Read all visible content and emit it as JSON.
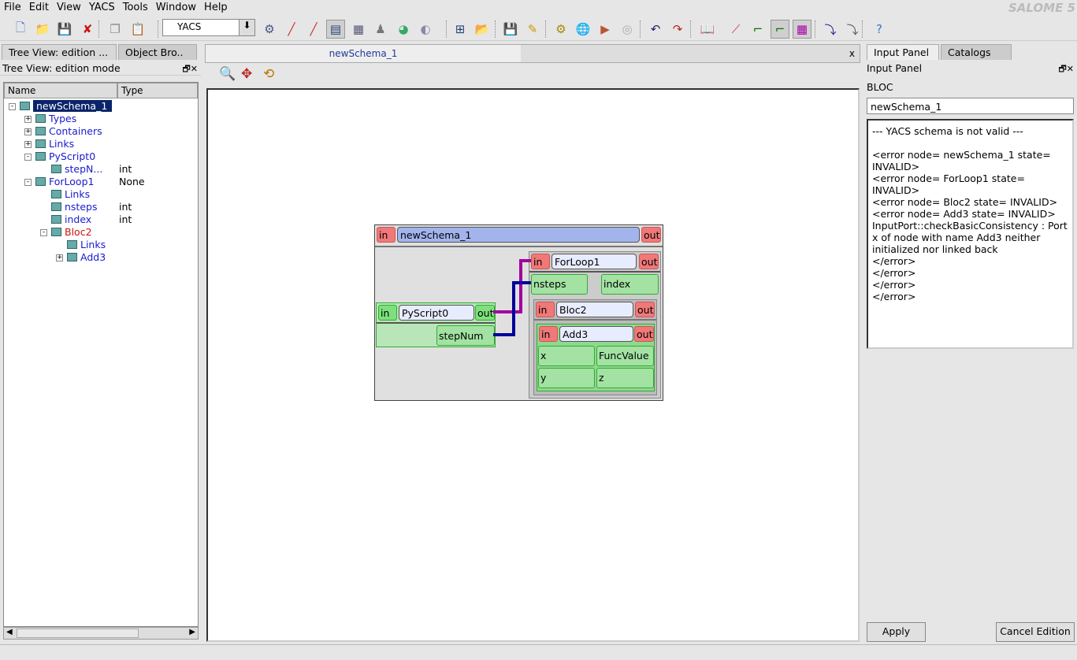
{
  "menu": [
    "File",
    "Edit",
    "View",
    "YACS",
    "Tools",
    "Window",
    "Help"
  ],
  "brand": "SALOME 5",
  "toolbar": {
    "module_combo": "YACS",
    "icons": [
      "new-icon",
      "open-icon",
      "save-icon",
      "close-icon",
      "copy-icon",
      "paste-icon",
      "dump-icon",
      "geom-icon",
      "smesh-icon",
      "tree-icon",
      "med-icon",
      "post-icon",
      "visu-icon",
      "extra-icon",
      "schema-icon",
      "import-icon",
      "save-schema-icon",
      "edit-icon",
      "settings-icon",
      "catalog-icon",
      "execute-icon",
      "stop-icon",
      "undo-icon",
      "redo-icon",
      "book-icon",
      "link-icon",
      "arrange-icon",
      "arrange2-icon",
      "grid-icon",
      "step-icon",
      "step2-icon",
      "whats-this-icon"
    ]
  },
  "left": {
    "tabs": [
      "Tree View: edition ...",
      "Object Bro.."
    ],
    "header": "Tree View: edition mode",
    "columns": [
      "Name",
      "Type"
    ],
    "rows": [
      {
        "name": "newSchema_1",
        "type": "",
        "level": 0,
        "color": "sel",
        "exp": "-"
      },
      {
        "name": "Types",
        "type": "",
        "level": 1,
        "color": "blue",
        "exp": "+"
      },
      {
        "name": "Containers",
        "type": "",
        "level": 1,
        "color": "blue",
        "exp": "+"
      },
      {
        "name": "Links",
        "type": "",
        "level": 1,
        "color": "blue",
        "exp": "+"
      },
      {
        "name": "PyScript0",
        "type": "",
        "level": 1,
        "color": "blue",
        "exp": "-"
      },
      {
        "name": "stepN...",
        "type": "int",
        "level": 2,
        "color": "blue",
        "exp": ""
      },
      {
        "name": "ForLoop1",
        "type": "None",
        "level": 1,
        "color": "blue",
        "exp": "-"
      },
      {
        "name": "Links",
        "type": "",
        "level": 2,
        "color": "blue",
        "exp": ""
      },
      {
        "name": "nsteps",
        "type": "int",
        "level": 2,
        "color": "blue",
        "exp": ""
      },
      {
        "name": "index",
        "type": "int",
        "level": 2,
        "color": "blue",
        "exp": ""
      },
      {
        "name": "Bloc2",
        "type": "",
        "level": 2,
        "color": "red",
        "exp": "-"
      },
      {
        "name": "Links",
        "type": "",
        "level": 3,
        "color": "blue",
        "exp": ""
      },
      {
        "name": "Add3",
        "type": "",
        "level": 3,
        "color": "blue",
        "exp": "+"
      }
    ]
  },
  "center": {
    "tab": "newSchema_1",
    "close": "x",
    "tools": [
      "zoom-icon",
      "pan-icon",
      "reset-view-icon"
    ],
    "schema": {
      "in": "in",
      "out": "out",
      "name": "newSchema_1",
      "pyscript": "PyScript0",
      "stepnum": "stepNum",
      "forloop": "ForLoop1",
      "nsteps": "nsteps",
      "index": "index",
      "bloc": "Bloc2",
      "add": "Add3",
      "x": "x",
      "y": "y",
      "funcvalue": "FuncValue",
      "z": "z"
    },
    "link_colors": {
      "control": "#a000a0",
      "data": "#00009a"
    }
  },
  "right": {
    "tabs": [
      "Input Panel",
      "Catalogs"
    ],
    "header": "Input Panel",
    "type_label": "BLOC",
    "name_value": "newSchema_1",
    "messages": [
      "--- YACS schema is not valid ---",
      "",
      "<error node= newSchema_1 state= INVALID>",
      "<error node= ForLoop1 state= INVALID>",
      "<error node= Bloc2 state= INVALID>",
      "<error node= Add3 state= INVALID>",
      "InputPort::checkBasicConsistency : Port x of node with name Add3 neither initialized nor linked back",
      "</error>",
      "</error>",
      "</error>",
      "</error>"
    ],
    "apply": "Apply",
    "cancel": "Cancel Edition"
  }
}
